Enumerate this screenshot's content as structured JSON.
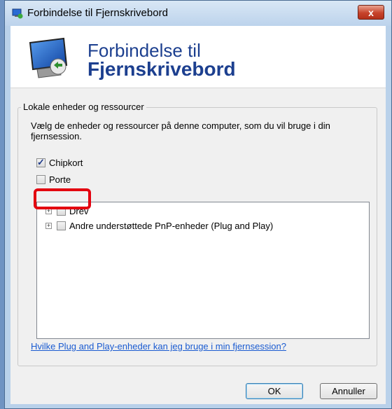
{
  "window": {
    "title": "Forbindelse til Fjernskrivebord",
    "close_label": "x"
  },
  "header": {
    "line1": "Forbindelse til",
    "line2": "Fjernskrivebord"
  },
  "group": {
    "legend": "Lokale enheder og ressourcer",
    "instruction": "Vælg de enheder og ressourcer på denne computer, som du vil bruge i din fjernsession.",
    "checkboxes": [
      {
        "label": "Chipkort",
        "checked": true
      },
      {
        "label": "Porte",
        "checked": false
      }
    ],
    "tree_items": [
      {
        "label": "Drev",
        "checked": false
      },
      {
        "label": "Andre understøttede PnP-enheder (Plug and Play)",
        "checked": false
      }
    ],
    "help_link": "Hvilke Plug and Play-enheder kan jeg bruge i min fjernsession?"
  },
  "buttons": {
    "ok": "OK",
    "cancel": "Annuller"
  },
  "icons": [
    "rdp-app-icon",
    "remote-desktop-icon",
    "close-icon",
    "expand-icon"
  ],
  "colors": {
    "header_text": "#1c3f8f",
    "link": "#1a5bd1",
    "highlight": "#e3000f"
  }
}
